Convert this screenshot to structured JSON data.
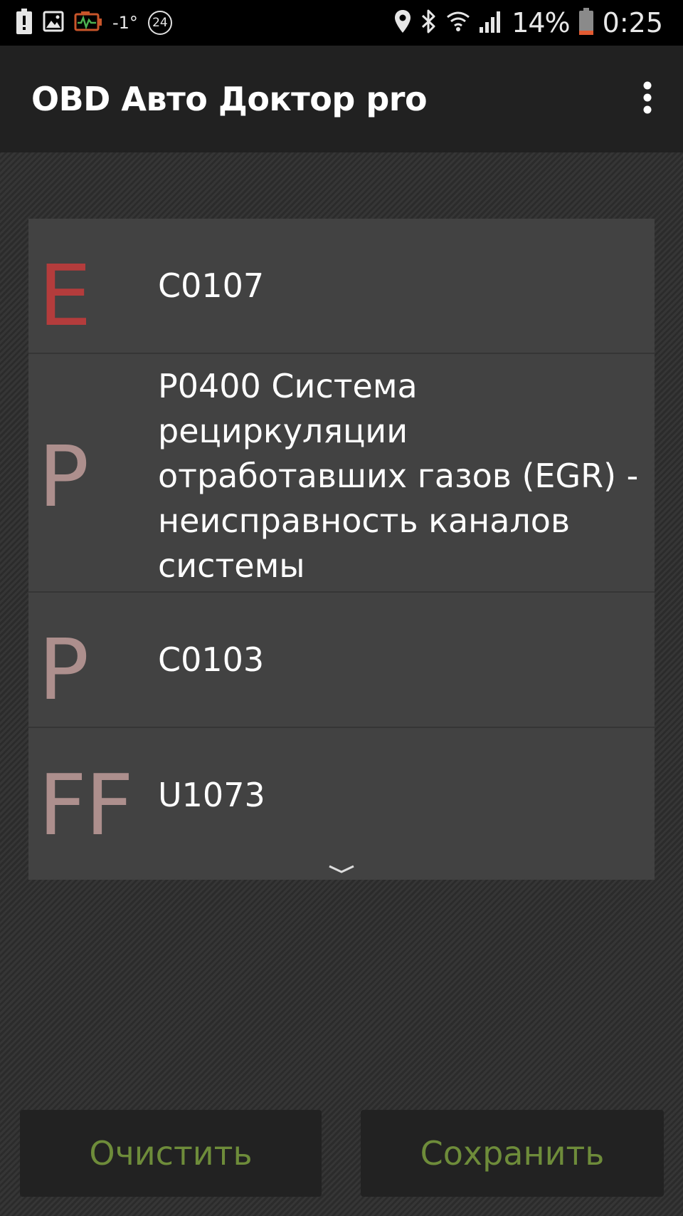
{
  "status_bar": {
    "temperature": "-1°",
    "badge_number": "24",
    "battery_percent": "14%",
    "time": "0:25",
    "left_icons": [
      "battery-alert-icon",
      "image-icon",
      "engine-monitor-icon"
    ],
    "right_icons": [
      "location-icon",
      "bluetooth-icon",
      "wifi-icon",
      "signal-icon",
      "battery-icon"
    ]
  },
  "app_bar": {
    "title": "OBD Авто Доктор pro",
    "menu_icon": "more-vert-icon"
  },
  "error_list": {
    "items": [
      {
        "type_letter": "E",
        "code_text": "C0107",
        "letter_color": "#b43c3c"
      },
      {
        "type_letter": "P",
        "code_text": "P0400 Система рециркуляции отработавших газов (EGR) - неисправность каналов системы",
        "letter_color": "#ad8f8d"
      },
      {
        "type_letter": "P",
        "code_text": "C0103",
        "letter_color": "#ad8f8d"
      },
      {
        "type_letter": "FF",
        "code_text": "U1073",
        "letter_color": "#ad8f8d"
      }
    ],
    "scroll_indicator_icon": "chevron-down-icon"
  },
  "actions": {
    "clear_label": "Очистить",
    "save_label": "Сохранить"
  },
  "colors": {
    "action_text": "#6e8c3a",
    "error_letter_red": "#b43c3c",
    "error_letter_muted": "#ad8f8d",
    "list_background": "#424242",
    "app_bar_background": "#212121"
  }
}
